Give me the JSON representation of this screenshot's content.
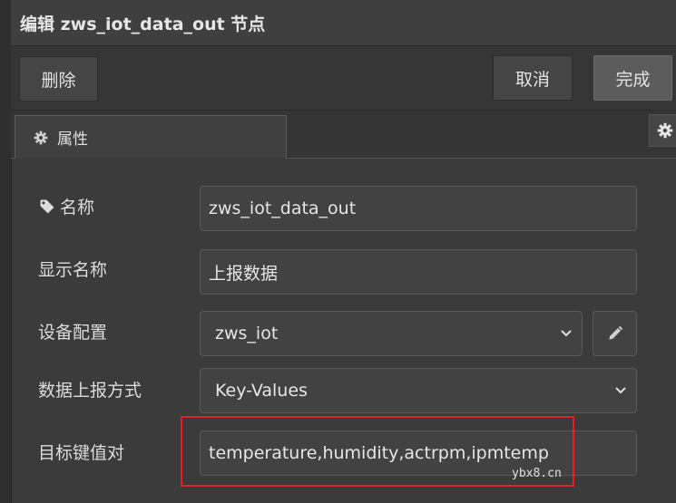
{
  "window": {
    "title": "编辑 zws_iot_data_out 节点"
  },
  "toolbar": {
    "delete_label": "删除",
    "cancel_label": "取消",
    "done_label": "完成"
  },
  "tabs": [
    {
      "label": "属性",
      "icon": "gear-icon"
    }
  ],
  "side_button": {
    "icon": "gear-icon"
  },
  "form": {
    "name": {
      "label": "名称",
      "icon": "tag-icon",
      "value": "zws_iot_data_out"
    },
    "display_name": {
      "label": "显示名称",
      "value": "上报数据"
    },
    "device_config": {
      "label": "设备配置",
      "value": "zws_iot",
      "edit_icon": "pencil-icon"
    },
    "report_mode": {
      "label": "数据上报方式",
      "value": "Key-Values"
    },
    "target_kv": {
      "label": "目标键值对",
      "value": "temperature,humidity,actrpm,ipmtemp"
    }
  },
  "watermark": "ybx8.cn",
  "colors": {
    "background": "#3b3b3b",
    "highlight_border": "#d9262c"
  }
}
